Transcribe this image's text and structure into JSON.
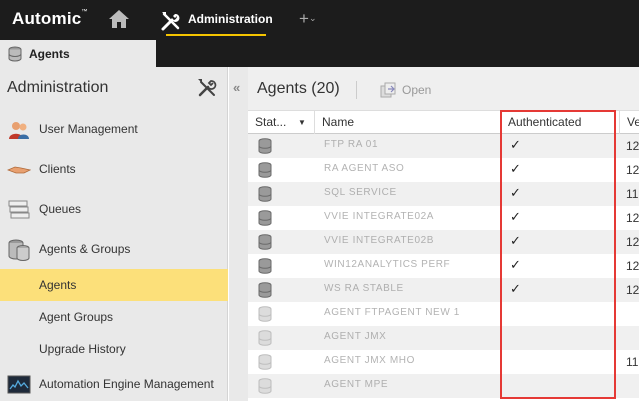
{
  "topbar": {
    "logo": "Automic",
    "logo_mark": "™",
    "admin_label": "Administration",
    "plus_label": "+",
    "plus_caret": "⌄"
  },
  "tab": {
    "label": "Agents"
  },
  "sidebar": {
    "title": "Administration",
    "items": [
      {
        "label": "User Management",
        "icon": "users-icon"
      },
      {
        "label": "Clients",
        "icon": "handshake-icon"
      },
      {
        "label": "Queues",
        "icon": "queue-icon"
      },
      {
        "label": "Agents & Groups",
        "icon": "database-icon"
      }
    ],
    "subitems": [
      {
        "label": "Agents",
        "active": true
      },
      {
        "label": "Agent Groups",
        "active": false
      },
      {
        "label": "Upgrade History",
        "active": false
      }
    ],
    "last_item": {
      "label": "Automation Engine Management",
      "icon": "monitor-icon"
    },
    "collapse_label": "«"
  },
  "main": {
    "title": "Agents (20)",
    "open_label": "Open",
    "columns": {
      "status": "Stat...",
      "sort_arrow": "▼",
      "name": "Name",
      "authenticated": "Authenticated",
      "version": "Ve"
    },
    "rows": [
      {
        "name": "FTP RA 01",
        "auth": "✓",
        "ver": "12",
        "active": true
      },
      {
        "name": "RA AGENT ASO",
        "auth": "✓",
        "ver": "12",
        "active": true
      },
      {
        "name": "SQL SERVICE",
        "auth": "✓",
        "ver": "11.",
        "active": true
      },
      {
        "name": "VVIE INTEGRATE02A",
        "auth": "✓",
        "ver": "12",
        "active": true
      },
      {
        "name": "VVIE INTEGRATE02B",
        "auth": "✓",
        "ver": "12",
        "active": true
      },
      {
        "name": "WIN12ANALYTICS PERF",
        "auth": "✓",
        "ver": "12",
        "active": true
      },
      {
        "name": "WS RA STABLE",
        "auth": "✓",
        "ver": "12",
        "active": true
      },
      {
        "name": "AGENT FTPAGENT NEW 1",
        "auth": "",
        "ver": "",
        "active": false
      },
      {
        "name": "AGENT JMX",
        "auth": "",
        "ver": "",
        "active": false
      },
      {
        "name": "AGENT JMX MHO",
        "auth": "",
        "ver": "11.",
        "active": false
      },
      {
        "name": "AGENT MPE",
        "auth": "",
        "ver": "",
        "active": false
      }
    ]
  },
  "colors": {
    "accent": "#f5c400",
    "active_row": "#fce07a",
    "highlight": "#e53935",
    "topbar": "#1c1c1c"
  }
}
